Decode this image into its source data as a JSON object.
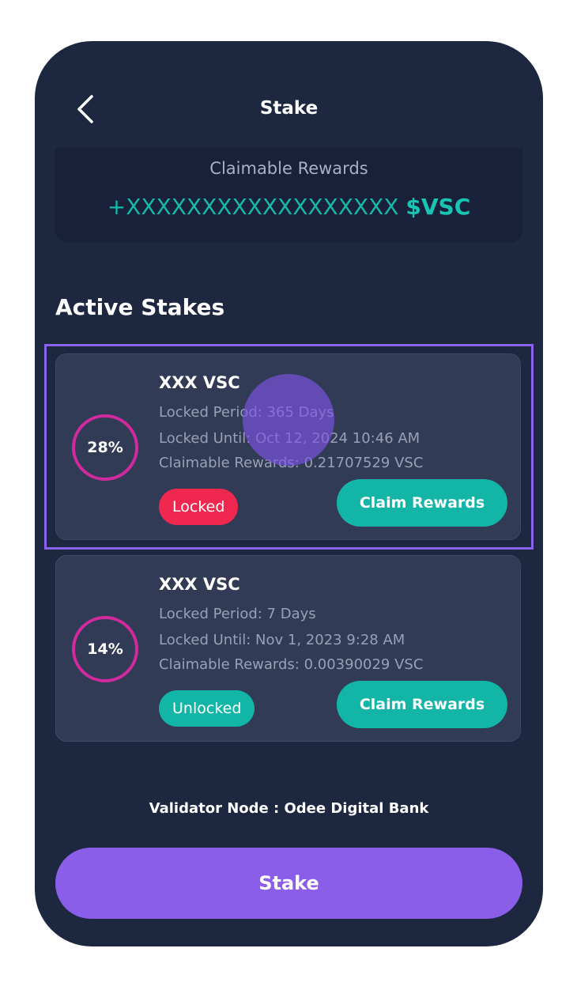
{
  "header": {
    "title": "Stake",
    "back_icon": "chevron-left-icon"
  },
  "rewards": {
    "label": "Claimable Rewards",
    "amount": "+XXXXXXXXXXXXXXXXXX",
    "unit": "$VSC"
  },
  "section": {
    "title": "Active Stakes"
  },
  "stakes": [
    {
      "percent": "28%",
      "title": "XXX VSC",
      "locked_period": "Locked Period: 365 Days",
      "locked_until": "Locked Until: Oct 12, 2024 10:46 AM",
      "claimable": "Claimable Rewards: 0.21707529 VSC",
      "status": "Locked",
      "button": "Claim Rewards"
    },
    {
      "percent": "14%",
      "title": "XXX VSC",
      "locked_period": "Locked Period: 7 Days",
      "locked_until": "Locked Until: Nov 1, 2023 9:28 AM",
      "claimable": "Claimable Rewards: 0.00390029 VSC",
      "status": "Unlocked",
      "button": "Claim Rewards"
    }
  ],
  "footer": {
    "validator": "Validator Node : Odee Digital Bank",
    "stake_button": "Stake"
  },
  "colors": {
    "background": "#1e2740",
    "card": "#323b55",
    "accent_teal": "#13b5a6",
    "accent_purple": "#8a5ee9",
    "locked_red": "#f0274f",
    "ring_magenta": "#d02a9e"
  }
}
